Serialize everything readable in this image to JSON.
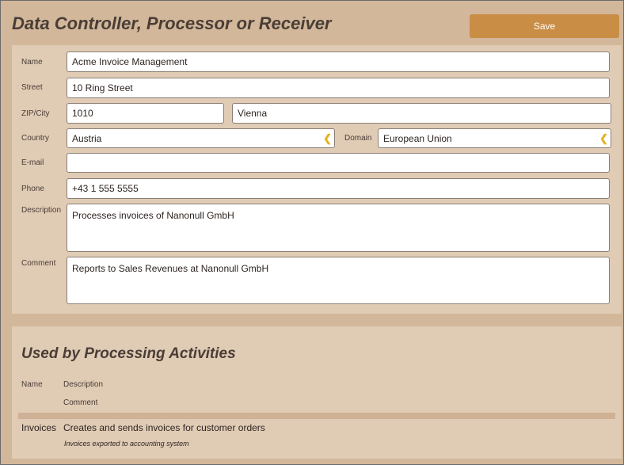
{
  "header": {
    "title": "Data Controller, Processor or Receiver",
    "save_label": "Save"
  },
  "form": {
    "name_label": "Name",
    "name_value": "Acme Invoice Management",
    "street_label": "Street",
    "street_value": "10 Ring Street",
    "zipcity_label": "ZIP/City",
    "zip_value": "1010",
    "city_value": "Vienna",
    "country_label": "Country",
    "country_value": "Austria",
    "domain_label": "Domain",
    "domain_value": "European Union",
    "email_label": "E-mail",
    "email_value": "",
    "phone_label": "Phone",
    "phone_value": "+43 1 555 5555",
    "description_label": "Description",
    "description_value": "Processes invoices of Nanonull GmbH",
    "comment_label": "Comment",
    "comment_value": "Reports to Sales Revenues at Nanonull GmbH",
    "dropdown_glyph": "❮"
  },
  "activities": {
    "title": "Used by Processing Activities",
    "col_name": "Name",
    "col_description": "Description",
    "col_comment": "Comment",
    "rows": [
      {
        "name": "Invoices",
        "description": "Creates and sends invoices for customer orders",
        "comment": "Invoices exported to accounting system"
      }
    ]
  },
  "colors": {
    "background": "#d2b79a",
    "panel": "#e0cbb5",
    "save_button": "#c98d45",
    "dropdown_arrow": "#e2b31a"
  }
}
